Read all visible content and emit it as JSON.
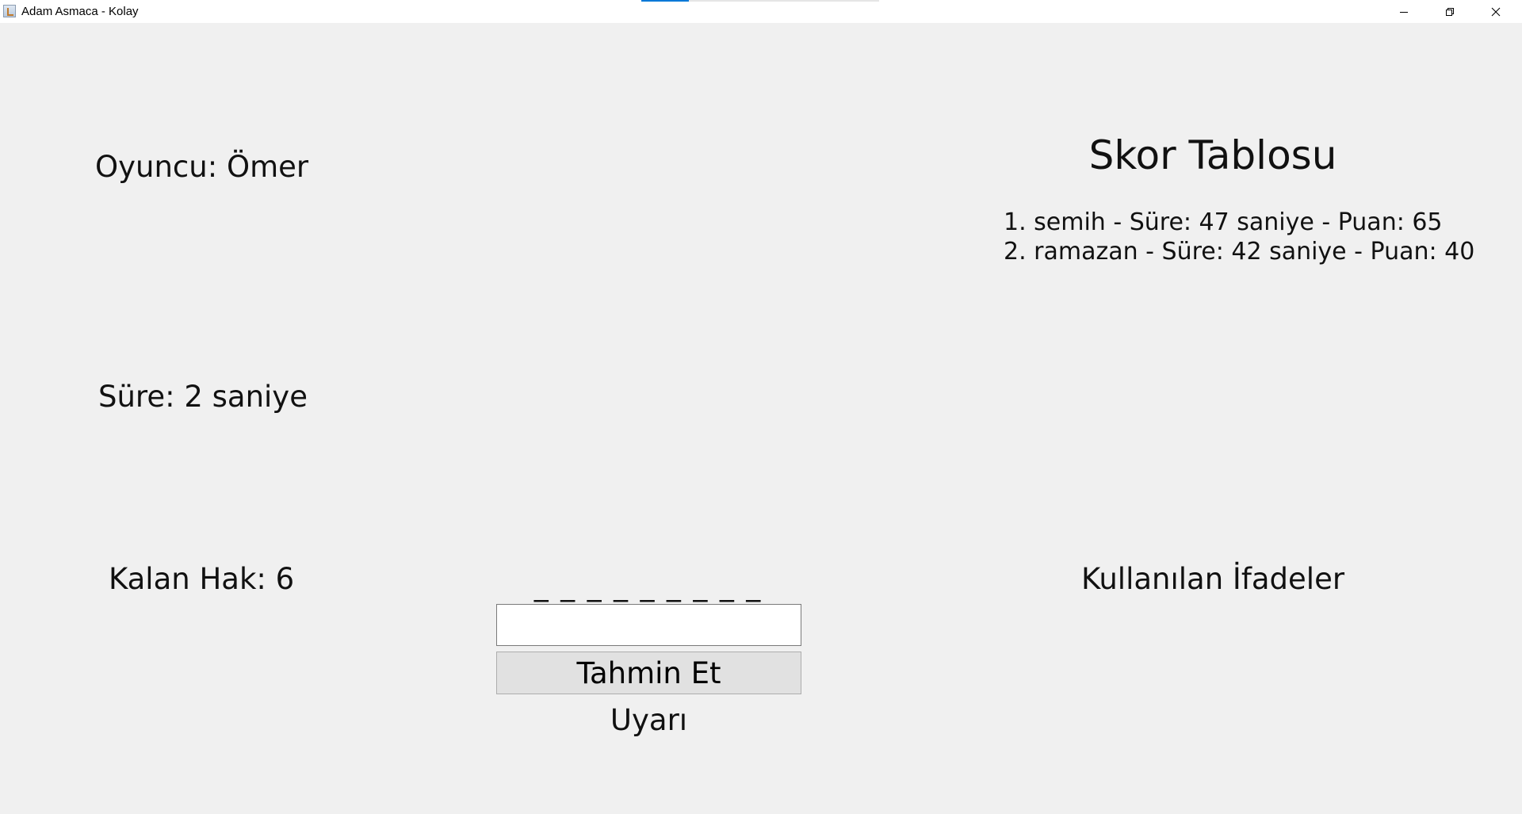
{
  "window": {
    "title": "Adam Asmaca - Kolay",
    "app_icon": "java-cup-icon",
    "controls": [
      "minimize-icon",
      "restore-icon",
      "close-icon"
    ]
  },
  "game": {
    "player_label": "Oyuncu: Ömer",
    "timer_label": "Süre: 2 saniye",
    "lives_label": "Kalan Hak: 6",
    "word_mask": "_ _ _ _ _ _ _ _ _",
    "guess_input_value": "",
    "guess_button_label": "Tahmin Et",
    "warning_label": "Uyarı"
  },
  "scoreboard": {
    "title": "Skor Tablosu",
    "entries": [
      "1. semih - Süre: 47 saniye - Puan: 65",
      "2. ramazan - Süre: 42 saniye - Puan: 40"
    ]
  },
  "used_expressions": {
    "title": "Kullanılan İfadeler"
  },
  "colors": {
    "background": "#f0f0f0",
    "titlebar": "#ffffff",
    "button": "#e1e1e1",
    "accent": "#0078d7"
  }
}
